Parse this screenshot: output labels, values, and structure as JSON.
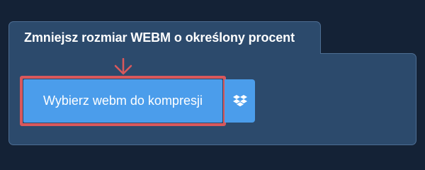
{
  "card": {
    "title": "Zmniejsz rozmiar WEBM o określony procent"
  },
  "upload": {
    "button_label": "Wybierz webm do kompresji",
    "cloud_icon": "dropbox-icon"
  },
  "colors": {
    "page_background": "#142236",
    "card_background": "#2c4a6c",
    "card_border": "#4d6d92",
    "button": "#4b9deb",
    "highlight": "#d9585c",
    "text": "#ffffff"
  }
}
